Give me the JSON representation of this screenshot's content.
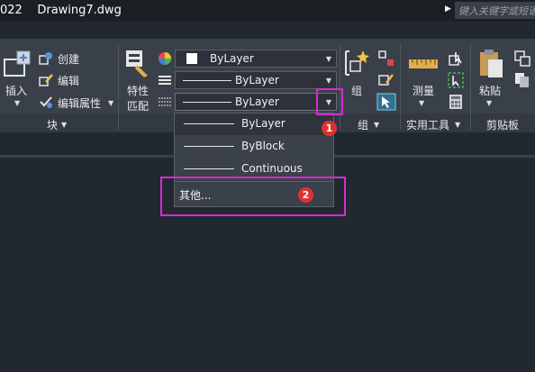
{
  "title": {
    "text": "022    Drawing7.dwg",
    "search_placeholder": "键入关键字或短语"
  },
  "ribbon": {
    "block": {
      "insert_label": "插入",
      "create_label": "创建",
      "edit_label": "编辑",
      "edit_attr_label": "编辑属性",
      "panel_label": "块"
    },
    "properties": {
      "match_label_line1": "特性",
      "match_label_line2": "匹配",
      "color_value": "ByLayer",
      "linetype_value": "ByLayer",
      "lineweight_value": "ByLayer"
    },
    "groups": {
      "group_label": "组",
      "panel_label": "组"
    },
    "utilities": {
      "measure_label": "测量",
      "panel_label": "实用工具"
    },
    "clipboard": {
      "paste_label": "粘贴",
      "panel_label": "剪贴板"
    }
  },
  "dropdown": {
    "options": [
      {
        "label": "ByLayer"
      },
      {
        "label": "ByBlock"
      },
      {
        "label": "Continuous"
      }
    ],
    "other_label": "其他..."
  },
  "annotations": {
    "badge1": "1",
    "badge2": "2"
  },
  "colors": {
    "highlight": "#d62bd1",
    "badge": "#e03131",
    "ribbon_bg": "#3a404a",
    "drawing_bg": "#212830"
  }
}
